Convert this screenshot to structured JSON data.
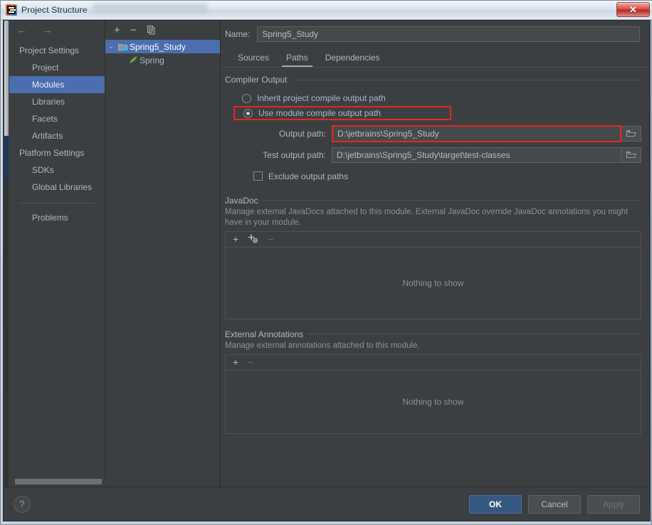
{
  "window": {
    "title": "Project Structure",
    "app_icon": "intellij-idea-logo",
    "close_label": "✕"
  },
  "sidebar": {
    "back_arrow": "←",
    "forward_arrow": "→",
    "groups": [
      {
        "label": "Project Settings"
      },
      {
        "label": "Platform Settings"
      }
    ],
    "items": [
      {
        "label": "Project",
        "selected": false
      },
      {
        "label": "Modules",
        "selected": true
      },
      {
        "label": "Libraries",
        "selected": false
      },
      {
        "label": "Facets",
        "selected": false
      },
      {
        "label": "Artifacts",
        "selected": false
      },
      {
        "label": "SDKs",
        "selected": false
      },
      {
        "label": "Global Libraries",
        "selected": false
      },
      {
        "label": "Problems",
        "selected": false
      }
    ]
  },
  "tree": {
    "toolbar": {
      "add": "+",
      "remove": "−",
      "copy": "copy-icon"
    },
    "nodes": [
      {
        "label": "Spring5_Study",
        "icon": "module-folder-icon",
        "chevron": "⌄",
        "selected": true
      },
      {
        "label": "Spring",
        "icon": "spring-leaf-icon",
        "chevron": "",
        "selected": false
      }
    ]
  },
  "main": {
    "name_label": "Name:",
    "name_value": "Spring5_Study",
    "name_placeholder": "",
    "tabs": [
      {
        "label": "Sources",
        "active": false
      },
      {
        "label": "Paths",
        "active": true
      },
      {
        "label": "Dependencies",
        "active": false
      }
    ],
    "compiler_output": {
      "title": "Compiler Output",
      "radio_inherit": "Inherit project compile output path",
      "radio_module": "Use module compile output path",
      "selected_radio": "module",
      "output_path_label": "Output path:",
      "output_path_value": "D:\\jetbrains\\Spring5_Study",
      "test_output_path_label": "Test output path:",
      "test_output_path_value": "D:\\jetbrains\\Spring5_Study\\target\\test-classes",
      "exclude_label": "Exclude output paths",
      "exclude_checked": false,
      "browse_icon": "folder-open-icon",
      "highlight_color": "#e8261c"
    },
    "javadoc": {
      "title": "JavaDoc",
      "description": "Manage external JavaDocs attached to this module. External JavaDoc override JavaDoc annotations you might have in your module.",
      "toolbar": {
        "add": "+",
        "add_url": "+",
        "remove": "−"
      },
      "empty_text": "Nothing to show"
    },
    "external_annotations": {
      "title": "External Annotations",
      "description": "Manage external annotations attached to this module.",
      "toolbar": {
        "add": "+",
        "remove": "−"
      },
      "empty_text": "Nothing to show"
    }
  },
  "footer": {
    "help_label": "?",
    "ok_label": "OK",
    "cancel_label": "Cancel",
    "apply_label": "Apply"
  },
  "colors": {
    "accent_selection": "#4b6eaf",
    "primary_button": "#365880",
    "panel_bg": "#3c3f41",
    "field_bg": "#45494a",
    "text": "#a9b7c6",
    "highlight": "#e8261c"
  }
}
